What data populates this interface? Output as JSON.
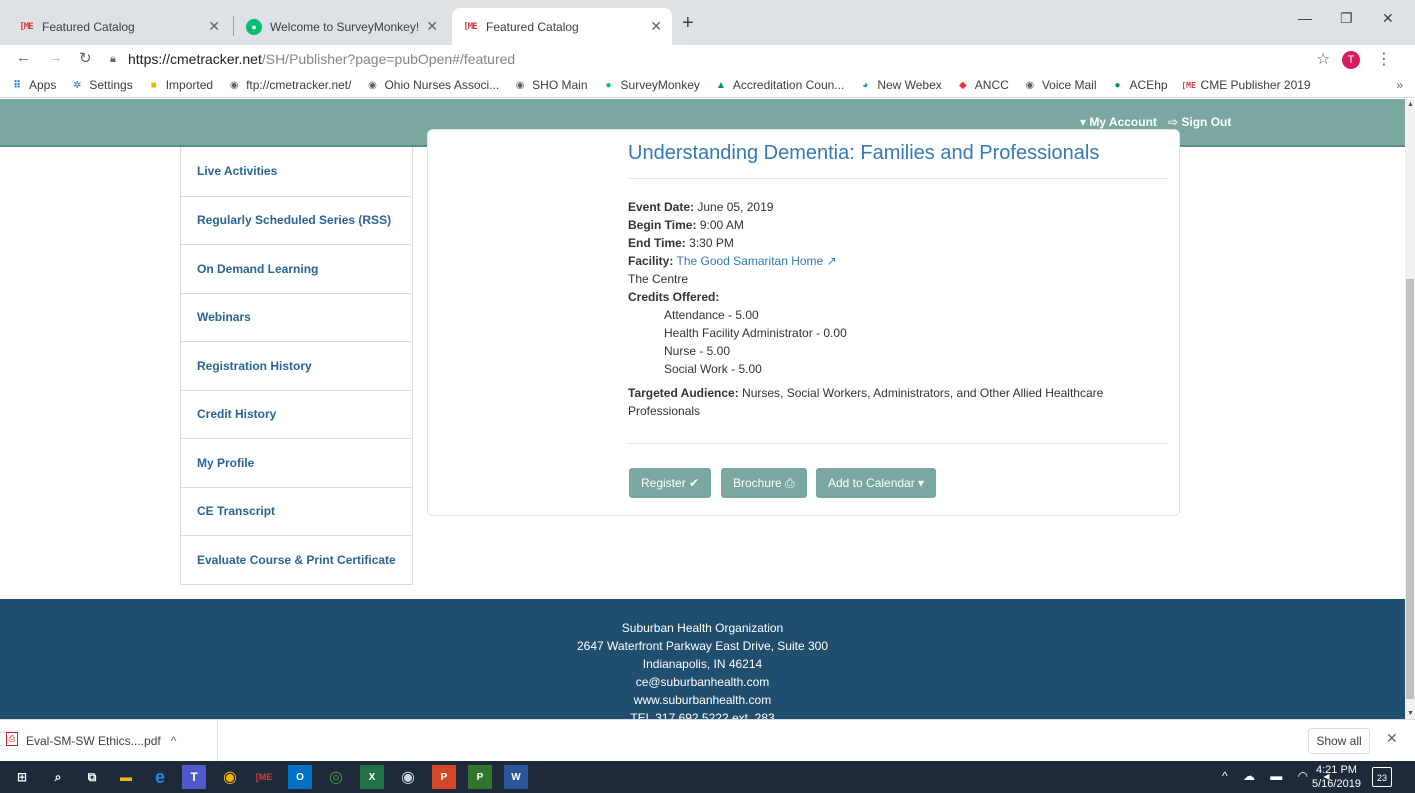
{
  "browser": {
    "tabs": [
      {
        "title": "Featured Catalog",
        "icon": "cme-favicon"
      },
      {
        "title": "Welcome to SurveyMonkey!",
        "icon": "surveymonkey-favicon"
      },
      {
        "title": "Featured Catalog",
        "icon": "cme-favicon",
        "active": true
      }
    ],
    "url_host": "https://cmetracker.net",
    "url_path": "/SH/Publisher?page=pubOpen#/featured",
    "profile_initial": "T",
    "bookmarks": [
      {
        "label": "Apps",
        "icon": "apps-grid-icon"
      },
      {
        "label": "Settings",
        "icon": "gear-icon"
      },
      {
        "label": "Imported",
        "icon": "folder-icon"
      },
      {
        "label": "ftp://cmetracker.net/",
        "icon": "globe-icon"
      },
      {
        "label": "Ohio Nurses Associ...",
        "icon": "globe-icon"
      },
      {
        "label": "SHO Main",
        "icon": "globe-icon"
      },
      {
        "label": "SurveyMonkey",
        "icon": "surveymonkey-icon"
      },
      {
        "label": "Accreditation Coun...",
        "icon": "acc-icon"
      },
      {
        "label": "New Webex",
        "icon": "webex-icon"
      },
      {
        "label": "ANCC",
        "icon": "ancc-icon"
      },
      {
        "label": "Voice Mail",
        "icon": "globe-icon"
      },
      {
        "label": "ACEhp",
        "icon": "acehp-icon"
      },
      {
        "label": "CME Publisher 2019",
        "icon": "cme-icon"
      }
    ],
    "bookmarks_more": "»"
  },
  "site": {
    "nav": {
      "my_account": "▾ My Account",
      "sign_out": "⇨ Sign Out"
    },
    "menu": [
      "Live Activities",
      "Regularly Scheduled Series (RSS)",
      "On Demand Learning",
      "Webinars",
      "Registration History",
      "Credit History",
      "My Profile",
      "CE Transcript",
      "Evaluate Course & Print Certificate"
    ],
    "event": {
      "title": "Understanding Dementia: Families and Professionals",
      "event_date_label": "Event Date:",
      "event_date": "June 05, 2019",
      "begin_label": "Begin Time:",
      "begin": "9:00 AM",
      "end_label": "End Time:",
      "end": "3:30 PM",
      "facility_label": "Facility:",
      "facility": "The Good Samaritan Home",
      "location": "The Centre",
      "credits_label": "Credits Offered:",
      "credits": [
        "Attendance - 5.00",
        "Health Facility Administrator - 0.00",
        "Nurse - 5.00",
        "Social Work - 5.00"
      ],
      "audience_label": "Targeted Audience:",
      "audience": "Nurses, Social Workers, Administrators, and Other Allied Healthcare Professionals",
      "buttons": {
        "register": "Register ✔",
        "brochure": "Brochure",
        "calendar": "Add to Calendar ▾"
      }
    },
    "footer": [
      "Suburban Health Organization",
      "2647 Waterfront Parkway East Drive, Suite 300",
      "Indianapolis, IN 46214",
      "ce@suburbanhealth.com",
      "www.suburbanhealth.com",
      "TEL 317 692 5222 ext. 283"
    ],
    "accent_color": "#7aa7a0",
    "footer_color": "#1f4e6e"
  },
  "downloads": {
    "file": "Eval-SM-SW Ethics....pdf",
    "show_all": "Show all"
  },
  "taskbar": {
    "time": "4:21 PM",
    "date": "5/16/2019",
    "notifications": "23"
  }
}
